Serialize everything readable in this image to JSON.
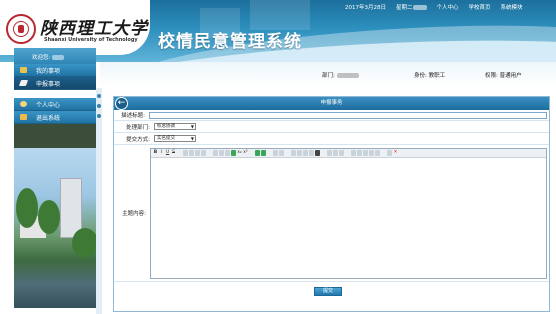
{
  "header": {
    "university_cn": "陕西理工大学",
    "university_en": "Shaanxi University of Technology",
    "system_title": "校情民意管理系统",
    "date": "2017年3月28日",
    "weekday": "星期二",
    "links": [
      "个人中心",
      "学校首页",
      "系统模块"
    ]
  },
  "info_bar": {
    "dept_label": "部门:",
    "identity_label": "身份:",
    "identity_value": "教职工",
    "permission_label": "权限:",
    "permission_value": "普通用户"
  },
  "sidebar": {
    "welcome_label": "欢迎您:",
    "items": [
      {
        "label": "我的事项",
        "icon": "folder-icon"
      },
      {
        "label": "申报事项",
        "icon": "pencil-icon"
      },
      {
        "label": "个人中心",
        "icon": "person-icon"
      },
      {
        "label": "退出系统",
        "icon": "key-icon"
      }
    ]
  },
  "panel": {
    "title": "申报事务",
    "back_icon": "back-arrow-icon",
    "fields": {
      "subject_label": "描述标题:",
      "subject_value": "",
      "dept_label": "处理部门:",
      "dept_value": "校总协调",
      "method_label": "提交方式:",
      "method_value": "实名提交",
      "content_label": "主题内容:"
    },
    "submit_label": "提交"
  },
  "toolbar": {
    "buttons": [
      "B",
      "I",
      "U",
      "S",
      "x₂",
      "x²"
    ]
  },
  "colors": {
    "header_blue": "#2d8fbd",
    "sidebar_blue": "#1f73a3",
    "panel_head": "#1d6c9e"
  }
}
